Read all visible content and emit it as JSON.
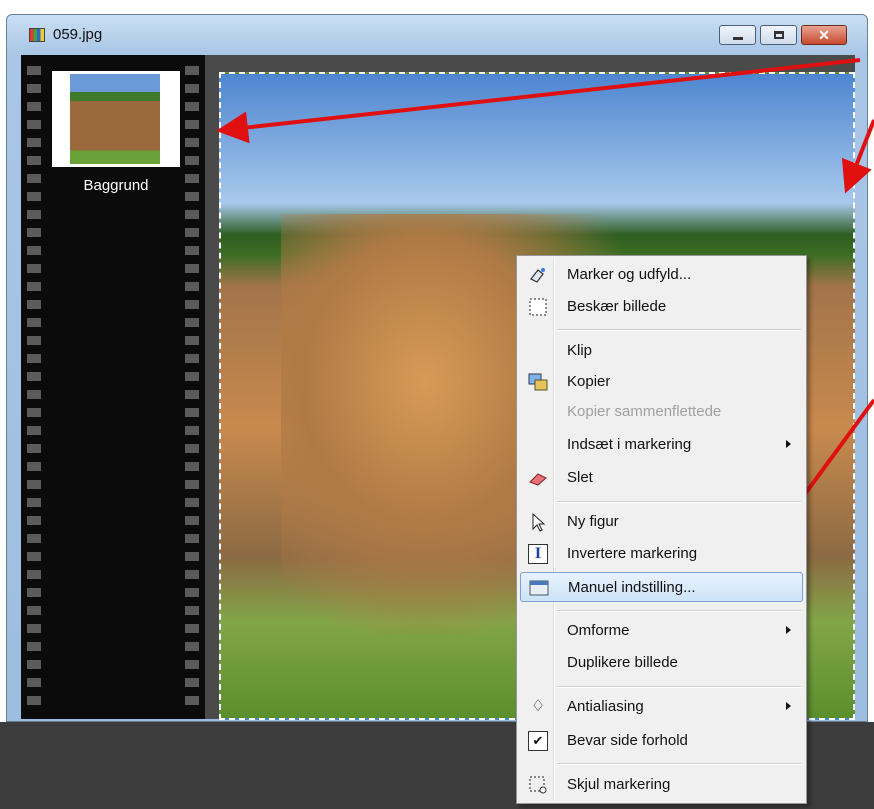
{
  "window": {
    "title": "059.jpg",
    "close_symbol": "✕"
  },
  "filmstrip": {
    "thumbnail_label": "Baggrund"
  },
  "context_menu": {
    "items": [
      {
        "label": "Marker og udfyld...",
        "icon": "magic-wand-icon"
      },
      {
        "label": "Beskær billede",
        "icon": "crop-icon"
      },
      {
        "label": "Klip",
        "icon": ""
      },
      {
        "label": "Kopier",
        "icon": "copy-icon"
      },
      {
        "label": "Kopier sammenflettede",
        "icon": "",
        "disabled": true
      },
      {
        "label": "Indsæt i markering",
        "icon": "",
        "submenu": true
      },
      {
        "label": "Slet",
        "icon": "eraser-icon"
      },
      {
        "label": "Ny figur",
        "icon": "pointer-icon"
      },
      {
        "label": "Invertere markering",
        "icon": "invert-icon"
      },
      {
        "label": "Manuel indstilling...",
        "icon": "settings-window-icon",
        "highlighted": true
      },
      {
        "label": "Omforme",
        "icon": "",
        "submenu": true
      },
      {
        "label": "Duplikere billede",
        "icon": ""
      },
      {
        "label": "Antialiasing",
        "icon": "drop-icon",
        "submenu": true
      },
      {
        "label": "Bevar side forhold",
        "icon": "checkmark-icon",
        "checked": true
      },
      {
        "label": "Skjul markering",
        "icon": "hide-selection-icon"
      }
    ],
    "icon_glyphs": {
      "invert": "I",
      "check": "✔",
      "drop": "♢"
    }
  },
  "colors": {
    "annotation_arrow": "#e01010",
    "menu_highlight": "#cde3f8"
  }
}
